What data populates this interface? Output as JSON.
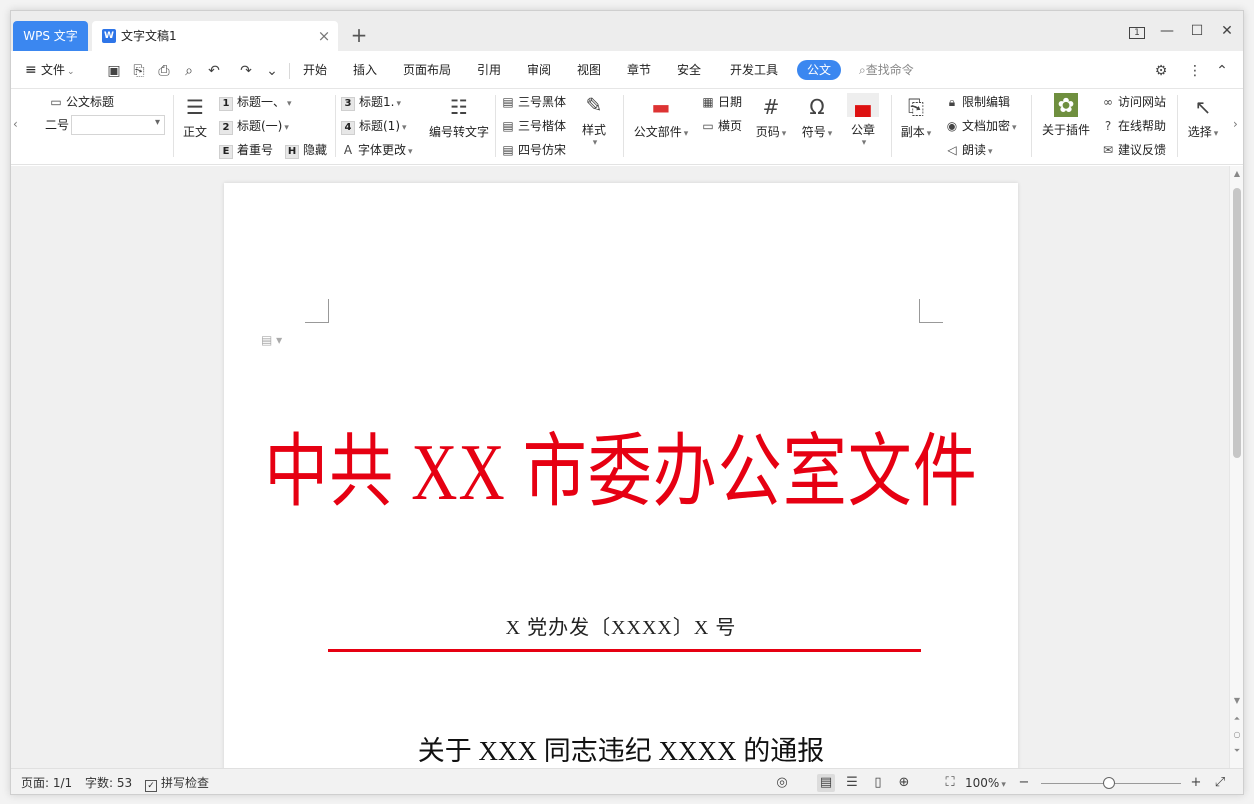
{
  "titlebar": {
    "app_tab": "WPS 文字",
    "doc_tab": "文字文稿1",
    "doc_tab_icon": "W",
    "add_tab": "+",
    "layout_badge": "1"
  },
  "menu": {
    "file": "文件",
    "tabs": [
      "开始",
      "插入",
      "页面布局",
      "引用",
      "审阅",
      "视图",
      "章节",
      "安全",
      "开发工具",
      "公文"
    ],
    "active_tab": "公文",
    "search": "查找命令"
  },
  "ribbon": {
    "title_style": "公文标题",
    "font_size": "二号",
    "body_text": "正文",
    "heading1": "标题一、",
    "heading2": "标题(一)",
    "emphasis": "着重号",
    "hide": "隐藏",
    "heading3_num": "3",
    "heading3": "标题1.",
    "heading4_num": "4",
    "heading4": "标题(1)",
    "font_change": "字体更改",
    "numbering_to_text": "编号转文字",
    "heiti": "三号黑体",
    "kaiti": "三号楷体",
    "fangsong": "四号仿宋",
    "style": "样式",
    "doc_parts": "公文部件",
    "date": "日期",
    "landscape": "横页",
    "page_number": "页码",
    "symbol": "符号",
    "seal": "公章",
    "copy": "副本",
    "restrict_edit": "限制编辑",
    "doc_encrypt": "文档加密",
    "read_aloud": "朗读",
    "about_plugin": "关于插件",
    "visit_site": "访问网站",
    "online_help": "在线帮助",
    "feedback": "建议反馈",
    "select": "选择"
  },
  "document": {
    "red_header": "中共 XX 市委办公室文件",
    "doc_number": "X 党办发〔XXXX〕X 号",
    "subject": "关于 XXX 同志违纪 XXXX 的通报"
  },
  "status": {
    "page": "页面: 1/1",
    "word_count": "字数: 53",
    "spell_check": "拼写检查",
    "zoom": "100%",
    "zoom_level_percent": 100
  },
  "colors": {
    "accent": "#3b87f0",
    "red_header": "#e60012"
  }
}
